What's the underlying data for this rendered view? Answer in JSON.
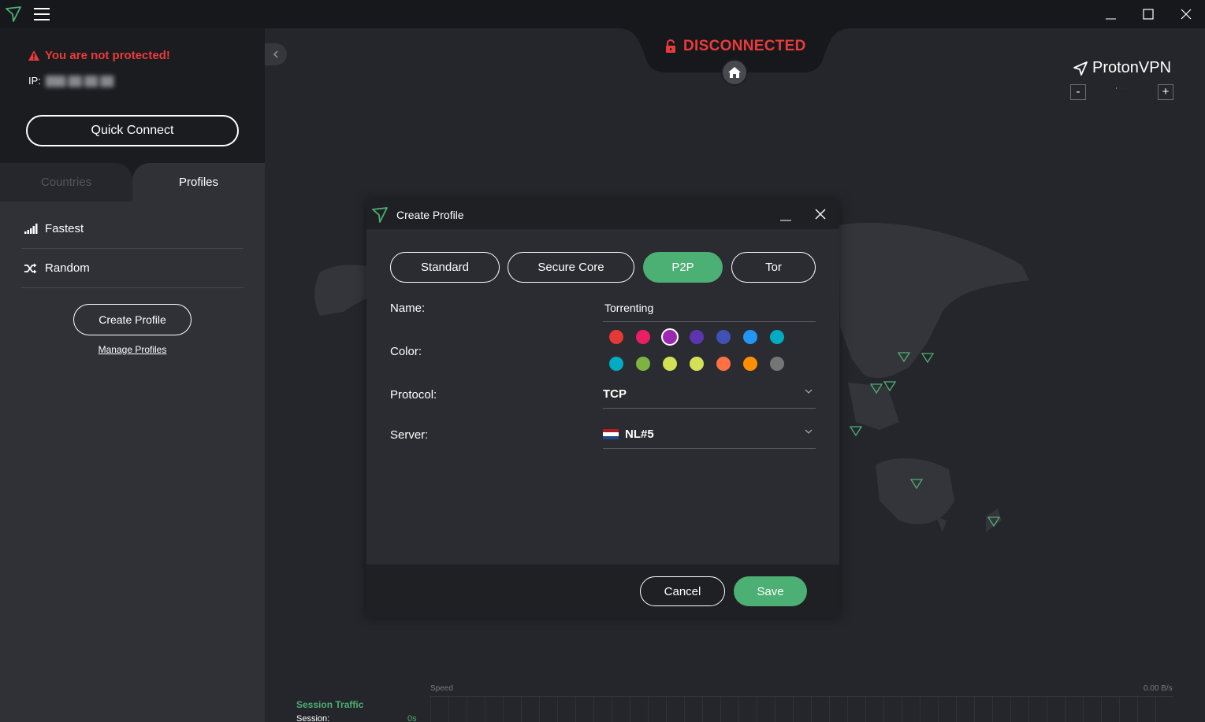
{
  "app": {
    "brand": "ProtonVPN",
    "colors": {
      "accent": "#4caf73",
      "danger": "#ea3b3b",
      "sidebar": "#303137",
      "titlebar": "#17181c"
    }
  },
  "sidebar": {
    "warning": "You are not protected!",
    "ip_label": "IP:",
    "ip_value": "███.██.██.██",
    "quick_connect": "Quick Connect",
    "tabs": {
      "countries": "Countries",
      "profiles": "Profiles"
    },
    "items": [
      {
        "label": "Fastest",
        "icon": "signal-bars-icon"
      },
      {
        "label": "Random",
        "icon": "shuffle-icon"
      }
    ],
    "create_profile": "Create Profile",
    "manage_profiles": "Manage Profiles"
  },
  "status": {
    "text": "DISCONNECTED",
    "icon": "lock-open-icon"
  },
  "zoom": {
    "minus": "-",
    "plus": "+"
  },
  "traffic": {
    "title": "Session Traffic",
    "session_label": "Session:",
    "session_value": "0s",
    "speed_label": "Speed",
    "speed_value": "0.00  B/s"
  },
  "dialog": {
    "title": "Create Profile",
    "types": [
      {
        "label": "Standard",
        "active": false
      },
      {
        "label": "Secure Core",
        "active": false
      },
      {
        "label": "P2P",
        "active": true
      },
      {
        "label": "Tor",
        "active": false
      }
    ],
    "name_label": "Name:",
    "name_value": "Torrenting",
    "color_label": "Color:",
    "colors": [
      "#e53935",
      "#e91e63",
      "#9c27b0",
      "#5e35b1",
      "#3f51b5",
      "#2196f3",
      "#00acc1",
      "#00acc1",
      "#7cb342",
      "#d4e157",
      "#d4e157",
      "#ff7043",
      "#ff8f00",
      "#757575"
    ],
    "selected_color_index": 2,
    "protocol_label": "Protocol:",
    "protocol_value": "TCP",
    "server_label": "Server:",
    "server_value": "NL#5",
    "cancel": "Cancel",
    "save": "Save"
  }
}
